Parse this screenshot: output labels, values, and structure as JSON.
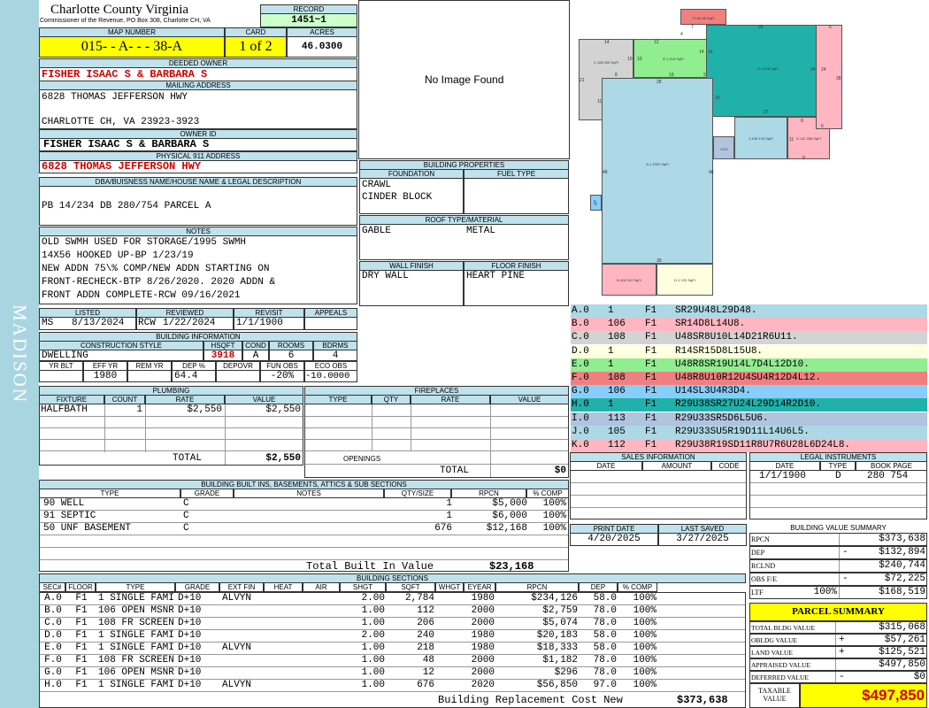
{
  "side_label": "MADISON",
  "header": {
    "county": "Charlotte County Virginia",
    "address": "Commissioner of the Revenue, PO Box 308, Charlotte CH, VA",
    "record_label": "RECORD",
    "record": "1451~1",
    "map_label": "MAP NUMBER",
    "map_number": "015- - A- - - 38-A",
    "card_label": "CARD",
    "card": "1 of 2",
    "acres_label": "ACRES",
    "acres": "46.0300"
  },
  "owner": {
    "deeded_label": "DEEDED OWNER",
    "deeded_owner": "FISHER ISAAC S & BARBARA S",
    "mailing_label": "MAILING ADDRESS",
    "mailing_line1": "6828 THOMAS JEFFERSON HWY",
    "mailing_line2": "CHARLOTTE CH, VA 23923-3923",
    "owner_id_label": "OWNER ID",
    "owner_id": "FISHER ISAAC S & BARBARA S",
    "physical_label": "PHYSICAL 911 ADDRESS",
    "physical": "6828 THOMAS JEFFERSON HWY"
  },
  "image": {
    "no_image": "No Image Found"
  },
  "dba": {
    "label": "DBA/BUISNESS NAME/HOUSE NAME & LEGAL DESCRIPTION",
    "text": "PB 14/234 DB 280/754 PARCEL A"
  },
  "notes": {
    "label": "NOTES",
    "lines": [
      "OLD SWMH USED FOR STORAGE/1995 SWMH",
      "14X56 HOOKED UP-BP 1/23/19",
      "NEW ADDN 75\\% COMP/NEW ADDN STARTING ON",
      "FRONT-RECHECK-BTP 8/26/2020. 2020 ADDN &",
      "FRONT ADDN COMPLETE-RCW 09/16/2021"
    ]
  },
  "building_props": {
    "label": "BUILDING PROPERTIES",
    "foundation_label": "FOUNDATION",
    "fuel_label": "FUEL TYPE",
    "foundation1": "CRAWL",
    "foundation2": "CINDER BLOCK",
    "roof_label": "ROOF TYPE/MATERIAL",
    "roof_type": "GABLE",
    "roof_material": "METAL",
    "wall_label": "WALL FINISH",
    "floor_label": "FLOOR FINISH",
    "wall": "DRY WALL",
    "floor": "HEART PINE"
  },
  "status": {
    "listed_label": "LISTED",
    "reviewed_label": "REVIEWED",
    "revisit_label": "REVISIT",
    "appeals_label": "APPEALS",
    "listed_by": "MS",
    "listed_date": "8/13/2024",
    "reviewed_by": "RCW",
    "reviewed_date": "1/22/2024",
    "revisit": "1/1/1900",
    "appeals": ""
  },
  "building_info": {
    "label": "BUILDING INFORMATION",
    "h_style": "CONSTRUCTION STYLE",
    "h_hsqft": "HSQFT",
    "h_cond": "COND",
    "h_rooms": "ROOMS",
    "h_bdrms": "BDRMS",
    "style": "DWELLING",
    "hsqft": "3918",
    "cond": "A",
    "rooms": "6",
    "bdrms": "4",
    "h_yrblt": "YR BLT",
    "h_effyr": "EFF YR",
    "h_remyr": "REM YR",
    "h_dep": "DEP %",
    "h_depovr": "DEPOVR",
    "h_funobs": "FUN OBS",
    "h_ecoobs": "ECO OBS",
    "yrblt": "",
    "effyr": "1980",
    "remyr": "",
    "dep": "64.4",
    "depovr": "",
    "funobs": "-20%",
    "ecoobs": "-10.0000"
  },
  "plumbing": {
    "label": "PLUMBING",
    "h_fixture": "FIXTURE",
    "h_count": "COUNT",
    "h_rate": "RATE",
    "h_value": "VALUE",
    "rows": [
      {
        "fixture": "HALFBATH",
        "count": "1",
        "rate": "$2,550",
        "value": "$2,550"
      }
    ],
    "total_label": "TOTAL",
    "total": "$2,550"
  },
  "fireplaces": {
    "label": "FIREPLACES",
    "h_type": "TYPE",
    "h_qty": "QTY",
    "h_rate": "RATE",
    "h_value": "VALUE",
    "openings_label": "OPENINGS",
    "total_label": "TOTAL",
    "total": "$0"
  },
  "built_ins": {
    "label": "BUILDING BUILT INS, BASEMENTS, ATTICS & SUB SECTIONS",
    "h_type": "TYPE",
    "h_grade": "GRADE",
    "h_notes": "NOTES",
    "h_qty": "QTY/SIZE",
    "h_rpcn": "RPCN",
    "h_comp": "% COMP",
    "rows": [
      {
        "type": "90 WELL",
        "grade": "C",
        "notes": "",
        "qty": "1",
        "rpcn": "$5,000",
        "comp": "100%"
      },
      {
        "type": "91 SEPTIC",
        "grade": "C",
        "notes": "",
        "qty": "1",
        "rpcn": "$6,000",
        "comp": "100%"
      },
      {
        "type": "50 UNF BASEMENT",
        "grade": "C",
        "notes": "",
        "qty": "676",
        "rpcn": "$12,168",
        "comp": "100%"
      }
    ],
    "total_label": "Total Built In Value",
    "total": "$23,168"
  },
  "sections": {
    "label": "BUILDING SECTIONS",
    "h": [
      "SEC#",
      "FLOOR",
      "TYPE",
      "GRADE",
      "EXT FIN",
      "HEAT",
      "AIR",
      "SHGT",
      "SQFT",
      "WHGT",
      "EYEAR",
      "RPCN",
      "DEP",
      "% COMP"
    ],
    "rows": [
      [
        "A.0",
        "F1",
        "1 SINGLE FAMILY",
        "D+10",
        "ALVYN",
        "",
        "",
        "2.00",
        "2,784",
        "",
        "1980",
        "$234,126",
        "58.0",
        "100%"
      ],
      [
        "B.0",
        "F1",
        "106 OPEN MSNRY PCH",
        "D+10",
        "",
        "",
        "",
        "1.00",
        "112",
        "",
        "2000",
        "$2,759",
        "78.0",
        "100%"
      ],
      [
        "C.0",
        "F1",
        "108 FR SCREEN PCH",
        "D+10",
        "",
        "",
        "",
        "1.00",
        "206",
        "",
        "2000",
        "$5,074",
        "78.0",
        "100%"
      ],
      [
        "D.0",
        "F1",
        "1 SINGLE FAMILY",
        "D+10",
        "",
        "",
        "",
        "2.00",
        "240",
        "",
        "1980",
        "$20,183",
        "58.0",
        "100%"
      ],
      [
        "E.0",
        "F1",
        "1 SINGLE FAMILY",
        "D+10",
        "ALVYN",
        "",
        "",
        "1.00",
        "218",
        "",
        "1980",
        "$18,333",
        "58.0",
        "100%"
      ],
      [
        "F.0",
        "F1",
        "108 FR SCREEN PCH",
        "D+10",
        "",
        "",
        "",
        "1.00",
        "48",
        "",
        "2000",
        "$1,182",
        "78.0",
        "100%"
      ],
      [
        "G.0",
        "F1",
        "106 OPEN MSNRY PCH",
        "D+10",
        "",
        "",
        "",
        "1.00",
        "12",
        "",
        "2000",
        "$296",
        "78.0",
        "100%"
      ],
      [
        "H.0",
        "F1",
        "1 SINGLE FAMILY",
        "D+10",
        "ALVYN",
        "",
        "",
        "1.00",
        "676",
        "",
        "2020",
        "$56,850",
        "97.0",
        "100%"
      ]
    ],
    "total_label": "Building Replacement Cost New",
    "total": "$373,638"
  },
  "sketch": {
    "labels": [
      {
        "id": "F.108",
        "text": "F.108 48 SqFt"
      },
      {
        "id": "C.108",
        "text": "C.108 206 SqFt"
      },
      {
        "id": "E.1",
        "text": "E.1 218 SqFt"
      },
      {
        "id": "H.1",
        "text": "H.1 676 SqFt"
      },
      {
        "id": "A.1",
        "text": "A.1 2392 SqFt"
      },
      {
        "id": "J.105",
        "text": "J.105 176 SqFt"
      },
      {
        "id": "I.113",
        "text": "I.113"
      },
      {
        "id": "K.112",
        "text": "K.112 256 SqFt"
      },
      {
        "id": "B.106",
        "text": "B.106 112 SqFt"
      },
      {
        "id": "D.1",
        "text": "D.1 120 SqFt"
      },
      {
        "id": "G",
        "text": "G"
      }
    ],
    "dims": [
      "14",
      "12",
      "4",
      "7",
      "28",
      "6",
      "10",
      "10",
      "14",
      "14",
      "21",
      "8",
      "11",
      "19",
      "2",
      "28",
      "24",
      "24",
      "28",
      "10",
      "27",
      "8",
      "6",
      "11",
      "8",
      "48",
      "48",
      "39",
      "6"
    ]
  },
  "legend": [
    {
      "sec": "A.0",
      "n": "1",
      "f": "F1",
      "code": "SR29U48L29D48.",
      "color": "#add8e6"
    },
    {
      "sec": "B.0",
      "n": "106",
      "f": "F1",
      "code": "SR14D8L14U8.",
      "color": "#ffb6c1"
    },
    {
      "sec": "C.0",
      "n": "108",
      "f": "F1",
      "code": "U48SR8U10L14D21R6U11.",
      "color": "#d3d3d3"
    },
    {
      "sec": "D.0",
      "n": "1",
      "f": "F1",
      "code": "R14SR15D8L15U8.",
      "color": "#ffffe0"
    },
    {
      "sec": "E.0",
      "n": "1",
      "f": "F1",
      "code": "U48R8SR19U14L7D4L12D10.",
      "color": "#90ee90"
    },
    {
      "sec": "F.0",
      "n": "108",
      "f": "F1",
      "code": "U48R8U10R12U4SU4R12D4L12.",
      "color": "#f08080"
    },
    {
      "sec": "G.0",
      "n": "106",
      "f": "F1",
      "code": "U14SL3U4R3D4.",
      "color": "#87cefa"
    },
    {
      "sec": "H.0",
      "n": "1",
      "f": "F1",
      "code": "R29U38SR27U24L29D14R2D10.",
      "color": "#20b2aa"
    },
    {
      "sec": "I.0",
      "n": "113",
      "f": "F1",
      "code": "R29U33SR5D6L5U6.",
      "color": "#b0c4de"
    },
    {
      "sec": "J.0",
      "n": "105",
      "f": "F1",
      "code": "R29U33SU5R19D11L14U6L5.",
      "color": "#add8e6"
    },
    {
      "sec": "K.0",
      "n": "112",
      "f": "F1",
      "code": "R29U38R19SD11R8U7R6U28L6D24L8.",
      "color": "#ffb6c1"
    }
  ],
  "sales": {
    "label": "SALES INFORMATION",
    "h_date": "DATE",
    "h_amount": "AMOUNT",
    "h_code": "CODE"
  },
  "legal": {
    "label": "LEGAL INSTRUMENTS",
    "h_date": "DATE",
    "h_type": "TYPE",
    "h_book": "BOOK PAGE",
    "date": "1/1/1900",
    "type": "D",
    "book": "280 754"
  },
  "print": {
    "print_label": "PRINT DATE",
    "saved_label": "LAST SAVED",
    "print_date": "4/20/2025",
    "last_saved": "3/27/2025"
  },
  "value_summary": {
    "label": "BUILDING VALUE SUMMARY",
    "rows": [
      {
        "name": "RPCN",
        "sign": "",
        "extra": "",
        "value": "$373,638"
      },
      {
        "name": "DEP",
        "sign": "-",
        "extra": "",
        "value": "$132,894"
      },
      {
        "name": "RCLND",
        "sign": "",
        "extra": "",
        "value": "$240,744"
      },
      {
        "name": "OBS F/E",
        "sign": "-",
        "extra": "",
        "value": "$72,225"
      },
      {
        "name": "LTF",
        "sign": "",
        "extra": "100%",
        "value": "$168,519"
      }
    ]
  },
  "parcel": {
    "label": "PARCEL SUMMARY",
    "rows": [
      {
        "name": "TOTAL BLDG VALUE",
        "sign": "",
        "value": "$315,068"
      },
      {
        "name": "OBLDG VALUE",
        "sign": "+",
        "value": "$57,261"
      },
      {
        "name": "LAND VALUE",
        "sign": "+",
        "value": "$125,521"
      },
      {
        "name": "APPRAISED VALUE",
        "sign": "",
        "value": "$497,850"
      },
      {
        "name": "DEFERRED VALUE",
        "sign": "-",
        "value": "$0"
      }
    ],
    "taxable_label1": "TAXABLE",
    "taxable_label2": "VALUE",
    "taxable": "$497,850"
  },
  "colors": {
    "side": "#a9d5e1",
    "header": "#bfe2ed",
    "yellow": "#ffff00",
    "green": "#ccffcc",
    "red": "#d00000"
  }
}
